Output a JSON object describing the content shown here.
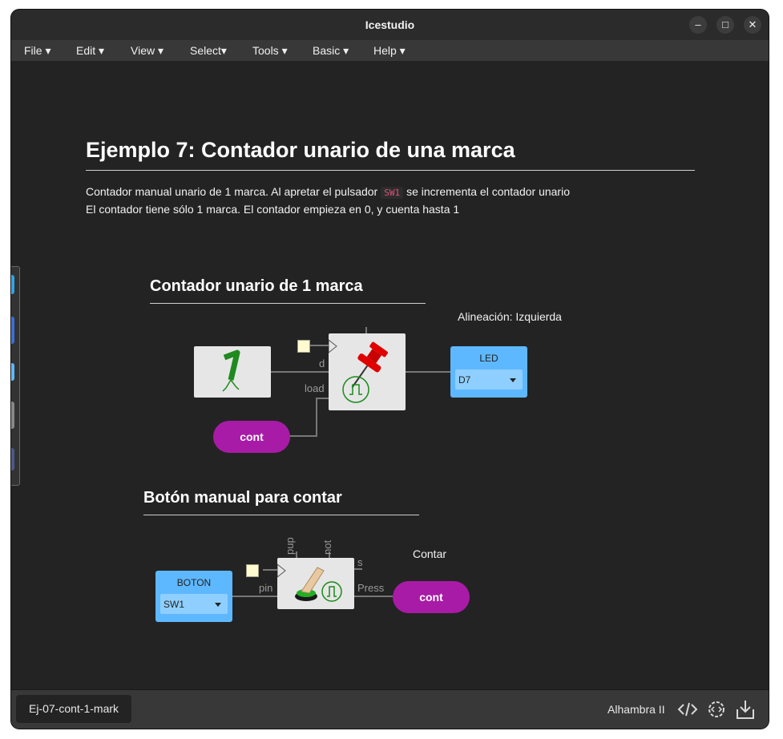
{
  "window": {
    "title": "Icestudio"
  },
  "menu": [
    "File",
    "Edit",
    "View",
    "Select",
    "Tools",
    "Basic",
    "Help"
  ],
  "doc": {
    "title": "Ejemplo 7: Contador unario de una marca",
    "line1_before": "Contador manual unario de 1 marca. Al apretar el pulsador",
    "line1_code": "SW1",
    "line1_after": "se incrementa el contador unario",
    "line2": "El contador tiene sólo 1 marca. El contador empieza en 0, y cuenta hasta 1"
  },
  "section1": {
    "title": "Contador unario de 1 marca",
    "note": "Alineación: Izquierda",
    "ports": {
      "d": "d",
      "load": "load"
    },
    "led": {
      "title": "LED",
      "pin": "D7"
    },
    "label": "cont"
  },
  "section2": {
    "title": "Botón manual para contar",
    "note": "Contar",
    "ports": {
      "pup": "pup",
      "not": "not",
      "s": "s",
      "pin": "pin",
      "press": "Press"
    },
    "boton": {
      "title": "BOTON",
      "pin": "SW1"
    },
    "label": "cont"
  },
  "status": {
    "filename": "Ej-07-cont-1-mark",
    "board": "Alhambra II"
  },
  "colors": {
    "io_block": "#5eb8ff",
    "label_pill": "#a81ba6",
    "canvas": "#232323"
  }
}
